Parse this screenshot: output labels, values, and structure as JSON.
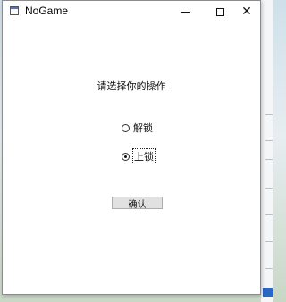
{
  "window": {
    "title": "NoGame"
  },
  "controls": {
    "minimize_icon": "minimize-icon",
    "maximize_icon": "maximize-icon",
    "close_icon": "close-icon",
    "close_glyph": "✕"
  },
  "main": {
    "prompt": "请选择你的操作",
    "options": [
      {
        "label": "解锁",
        "checked": false
      },
      {
        "label": "上锁",
        "checked": true
      }
    ],
    "confirm_label": "确认"
  }
}
